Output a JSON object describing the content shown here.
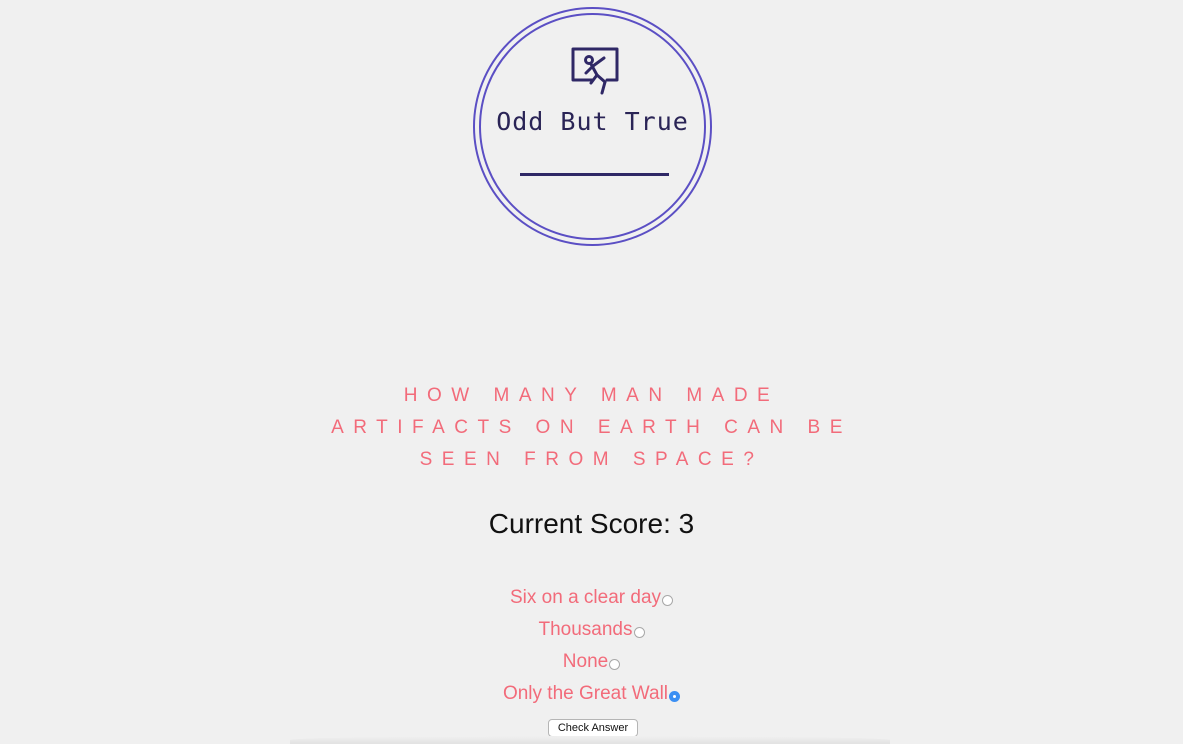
{
  "logo": {
    "title": "Odd But True",
    "icon": "person-jumping-out-of-frame-icon",
    "accent_color": "#5b4fc4"
  },
  "quiz": {
    "question": "How many man made artifacts on Earth can be seen from space?",
    "score_label": "Current Score: 3",
    "options": [
      {
        "label": "Six on a clear day",
        "selected": false
      },
      {
        "label": "Thousands",
        "selected": false
      },
      {
        "label": "None",
        "selected": false
      },
      {
        "label": "Only the Great Wall",
        "selected": true
      }
    ],
    "submit_label": "Check Answer",
    "text_color": "#f26b7a",
    "radio_selected_color": "#3b8ff3"
  }
}
